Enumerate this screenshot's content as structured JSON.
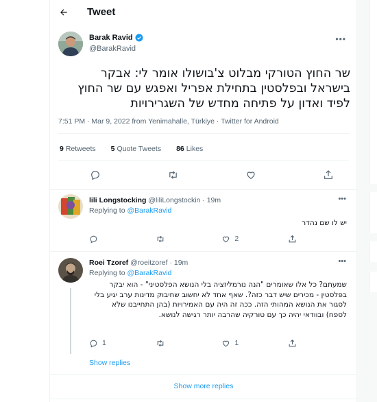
{
  "header": {
    "title": "Tweet"
  },
  "tweet": {
    "author_name": "Barak Ravid",
    "author_handle": "@BarakRavid",
    "text": "שר החוץ הטורקי מבלוט צ'בושולו אומר לי: אבקר בישראל ובפלסטין בתחילת אפריל ואפגש עם שר החוץ לפיד ואדון על פתיחה מחדש של השגרירויות",
    "meta": "7:51 PM · Mar 9, 2022 from Yenimahalle, Türkiye · Twitter for Android",
    "retweets_count": "9",
    "retweets_label": "Retweets",
    "quotes_count": "5",
    "quotes_label": "Quote Tweets",
    "likes_count": "86",
    "likes_label": "Likes"
  },
  "replies": [
    {
      "name": "lili Longstocking",
      "handle": "@liliLongstockin",
      "time": "· 19m",
      "replying_prefix": "Replying to",
      "replying_to": "@BarakRavid",
      "text": "יש לו שם נהדר",
      "reply_count": "",
      "retweet_count": "",
      "like_count": "2"
    },
    {
      "name": "Roei Tzoref",
      "handle": "@roeitzoref",
      "time": "· 19m",
      "replying_prefix": "Replying to",
      "replying_to": "@BarakRavid",
      "text": "שמעתם? כל אלו שאומרים \"הנה נורמליזציה בלי הנושא הפלסטיני\" - הוא יבקר בפלסטין - מכירים שיש דבר כזה?. שאף אחד לא יחשוב שחיבוק מדינות ערב יגיע בלי לסגור את הנושא המהותי הזה. ככה זה היה עם האמירויות (בהן התחייבנו שלא לספח) ובוודאי יהיה כך עם טורקיה שהרבה יותר רגישה לנושא.",
      "reply_count": "1",
      "retweet_count": "",
      "like_count": "1"
    }
  ],
  "show_replies_label": "Show replies",
  "show_more_label": "Show more replies",
  "colors": {
    "accent": "#1d9bf0",
    "text": "#0f1419",
    "muted": "#536471",
    "border": "#eff3f4"
  },
  "icons": [
    "back-arrow-icon",
    "verified-badge-icon",
    "more-icon",
    "reply-icon",
    "retweet-icon",
    "like-icon",
    "share-icon"
  ]
}
